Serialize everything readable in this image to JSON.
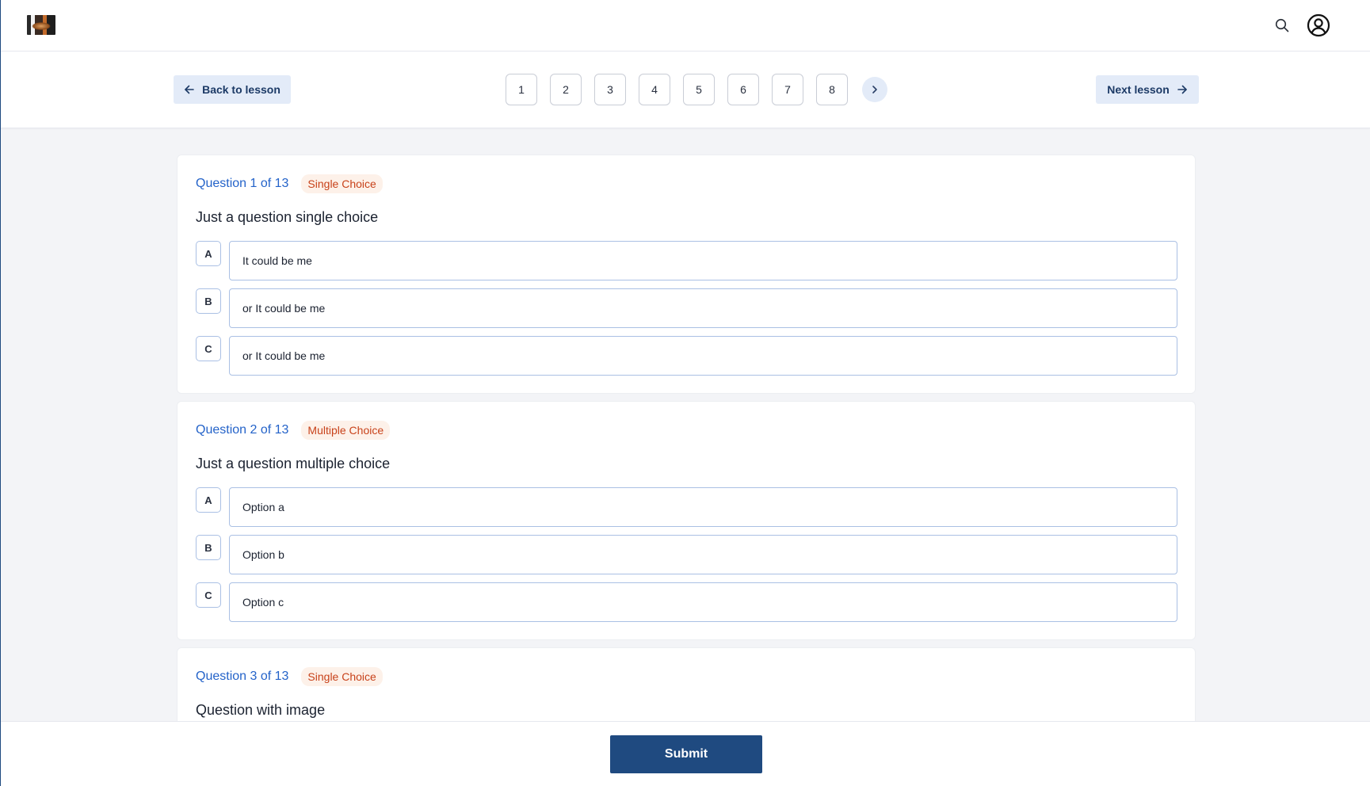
{
  "header": {
    "logo_icon": "logo-image",
    "search_icon": "search-icon",
    "account_icon": "user-circle-icon"
  },
  "lesson_nav": {
    "back_label": "Back to lesson",
    "next_label": "Next lesson",
    "pages": [
      "1",
      "2",
      "3",
      "4",
      "5",
      "6",
      "7",
      "8"
    ],
    "pager_next_icon": "chevron-right-icon"
  },
  "questions": [
    {
      "number": "Question 1 of 13",
      "type": "Single Choice",
      "text": "Just a question single choice",
      "options": [
        {
          "letter": "A",
          "text": "It could be me"
        },
        {
          "letter": "B",
          "text": "or It could be me"
        },
        {
          "letter": "C",
          "text": "or It could be me"
        }
      ]
    },
    {
      "number": "Question 2 of 13",
      "type": "Multiple Choice",
      "text": "Just a question multiple choice",
      "options": [
        {
          "letter": "A",
          "text": "Option a"
        },
        {
          "letter": "B",
          "text": "Option b"
        },
        {
          "letter": "C",
          "text": "Option c"
        }
      ]
    },
    {
      "number": "Question 3 of 13",
      "type": "Single Choice",
      "text": "Question with image",
      "options": []
    }
  ],
  "footer": {
    "submit_label": "Submit"
  },
  "colors": {
    "accent": "#1f4a80",
    "link": "#2463c9",
    "badge_text": "#c8421a",
    "badge_bg": "#fdf1e9",
    "nav_button_bg": "#e3ebf8"
  }
}
